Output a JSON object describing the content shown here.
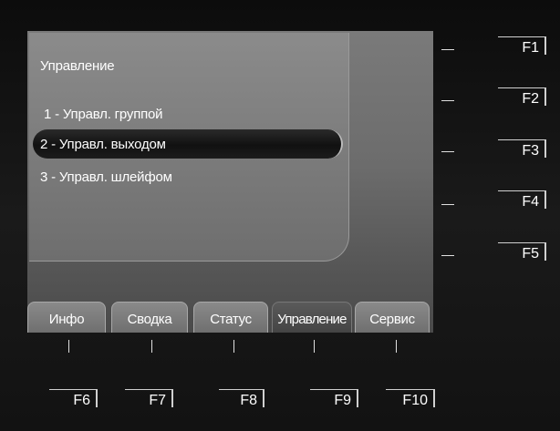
{
  "panel": {
    "title": "Управление",
    "items": [
      {
        "label": "1 - Управл. группой"
      },
      {
        "label": "2 - Управл. выходом"
      },
      {
        "label": "3 - Управл. шлейфом"
      }
    ],
    "selected_index": 1
  },
  "tabs": [
    {
      "label": "Инфо"
    },
    {
      "label": "Сводка"
    },
    {
      "label": "Статус"
    },
    {
      "label": "Управление"
    },
    {
      "label": "Сервис"
    }
  ],
  "active_tab": "Управление",
  "right_keys": [
    "F1",
    "F2",
    "F3",
    "F4",
    "F5"
  ],
  "bottom_keys": [
    "F6",
    "F7",
    "F8",
    "F9",
    "F10"
  ]
}
